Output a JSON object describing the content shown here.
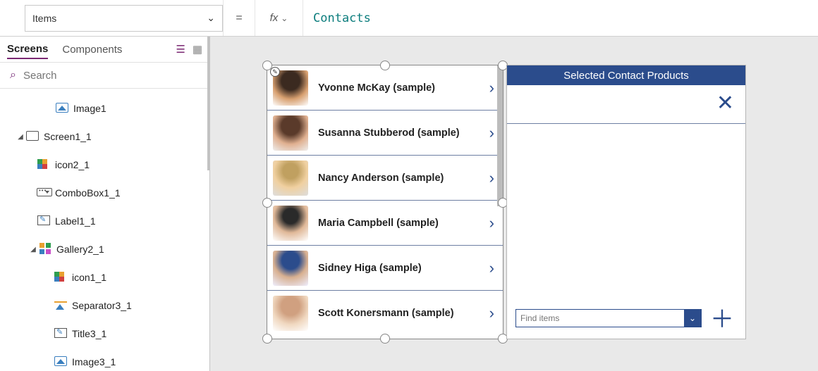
{
  "formula_bar": {
    "property": "Items",
    "equals": "=",
    "fx": "fx",
    "value": "Contacts"
  },
  "tabs": {
    "screens": "Screens",
    "components": "Components"
  },
  "search": {
    "placeholder": "Search"
  },
  "tree": {
    "image1": "Image1",
    "screen1": "Screen1_1",
    "icon2": "icon2_1",
    "combobox1": "ComboBox1_1",
    "label1": "Label1_1",
    "gallery2": "Gallery2_1",
    "icon1": "icon1_1",
    "separator3": "Separator3_1",
    "title3": "Title3_1",
    "image3": "Image3_1"
  },
  "gallery": {
    "items": [
      "Yvonne McKay (sample)",
      "Susanna Stubberod (sample)",
      "Nancy Anderson (sample)",
      "Maria Campbell (sample)",
      "Sidney Higa (sample)",
      "Scott Konersmann (sample)"
    ]
  },
  "right": {
    "header": "Selected Contact Products",
    "find_placeholder": "Find items"
  }
}
